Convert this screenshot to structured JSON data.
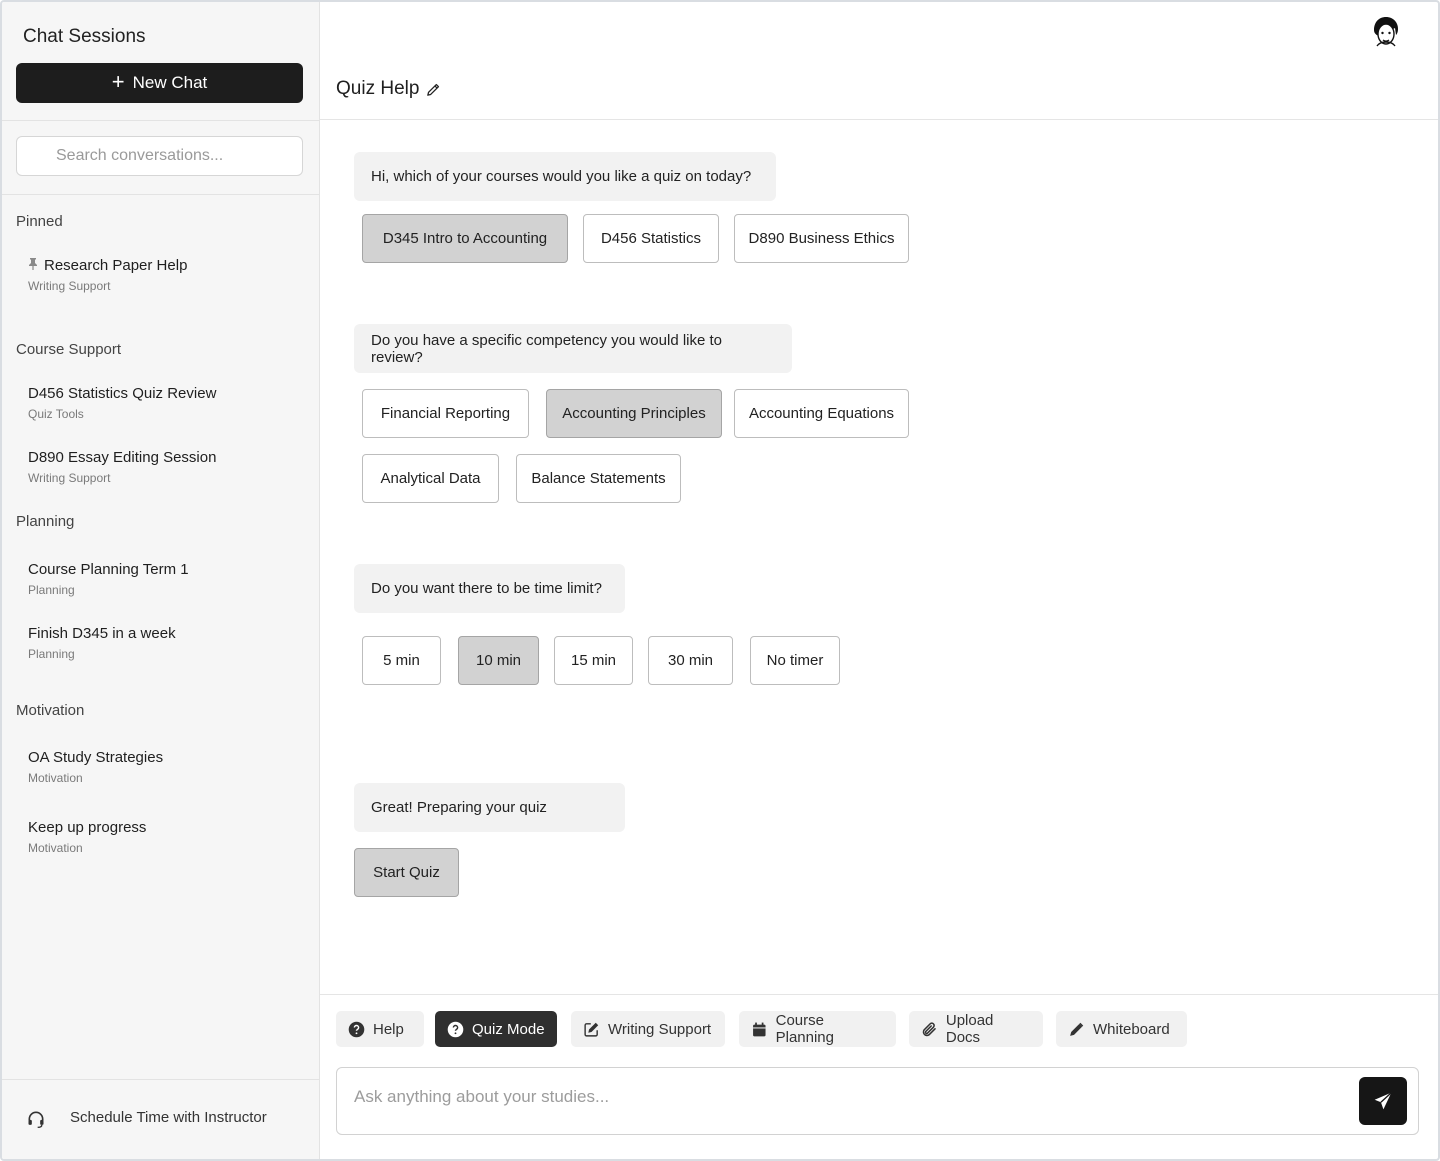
{
  "sidebar": {
    "title": "Chat Sessions",
    "new_chat_label": "New Chat",
    "search_placeholder": "Search conversations...",
    "sections": [
      {
        "heading": "Pinned",
        "items": [
          {
            "title": "Research Paper Help",
            "subtitle": "Writing Support",
            "pinned": true
          }
        ]
      },
      {
        "heading": "Course Support",
        "items": [
          {
            "title": "D456 Statistics Quiz Review",
            "subtitle": "Quiz Tools"
          },
          {
            "title": "D890 Essay Editing Session",
            "subtitle": "Writing Support"
          }
        ]
      },
      {
        "heading": "Planning",
        "items": [
          {
            "title": "Course Planning Term 1",
            "subtitle": "Planning"
          },
          {
            "title": "Finish D345 in a week",
            "subtitle": "Planning"
          }
        ]
      },
      {
        "heading": "Motivation",
        "items": [
          {
            "title": "OA Study Strategies",
            "subtitle": "Motivation"
          },
          {
            "title": "Keep up progress",
            "subtitle": "Motivation"
          }
        ]
      }
    ],
    "footer_label": "Schedule Time with Instructor",
    "footer_icon": "headset-icon"
  },
  "main": {
    "title": "Quiz Help",
    "messages": [
      {
        "text": "Hi, which of your courses would you like a quiz on today?",
        "options": [
          "D345 Intro to Accounting",
          "D456 Statistics",
          "D890 Business Ethics"
        ],
        "selected": "D345 Intro to Accounting"
      },
      {
        "text": "Do you have a specific competency you would like to review?",
        "options": [
          "Financial Reporting",
          "Accounting Principles",
          "Accounting Equations",
          "Analytical Data",
          "Balance Statements"
        ],
        "selected": "Accounting Principles"
      },
      {
        "text": "Do you want there to be time limit?",
        "options": [
          "5 min",
          "10 min",
          "15 min",
          "30 min",
          "No timer"
        ],
        "selected": "10 min"
      },
      {
        "text": "Great! Preparing your quiz",
        "options": [
          "Start Quiz"
        ],
        "selected": "Start Quiz"
      }
    ],
    "modes": [
      {
        "label": "Help",
        "icon": "question-circle-icon",
        "active": false
      },
      {
        "label": "Quiz Mode",
        "icon": "question-circle-icon",
        "active": true
      },
      {
        "label": "Writing Support",
        "icon": "edit-square-icon",
        "active": false
      },
      {
        "label": "Course Planning",
        "icon": "calendar-icon",
        "active": false
      },
      {
        "label": "Upload Docs",
        "icon": "paperclip-icon",
        "active": false
      },
      {
        "label": "Whiteboard",
        "icon": "pencil-icon",
        "active": false
      }
    ],
    "input_placeholder": "Ask anything about your studies..."
  },
  "colors": {
    "primary_dark": "#1d1d1d",
    "selected_option": "#d2d2d2",
    "bubble_bg": "#f2f2f2",
    "sidebar_bg": "#f6f6f6"
  }
}
